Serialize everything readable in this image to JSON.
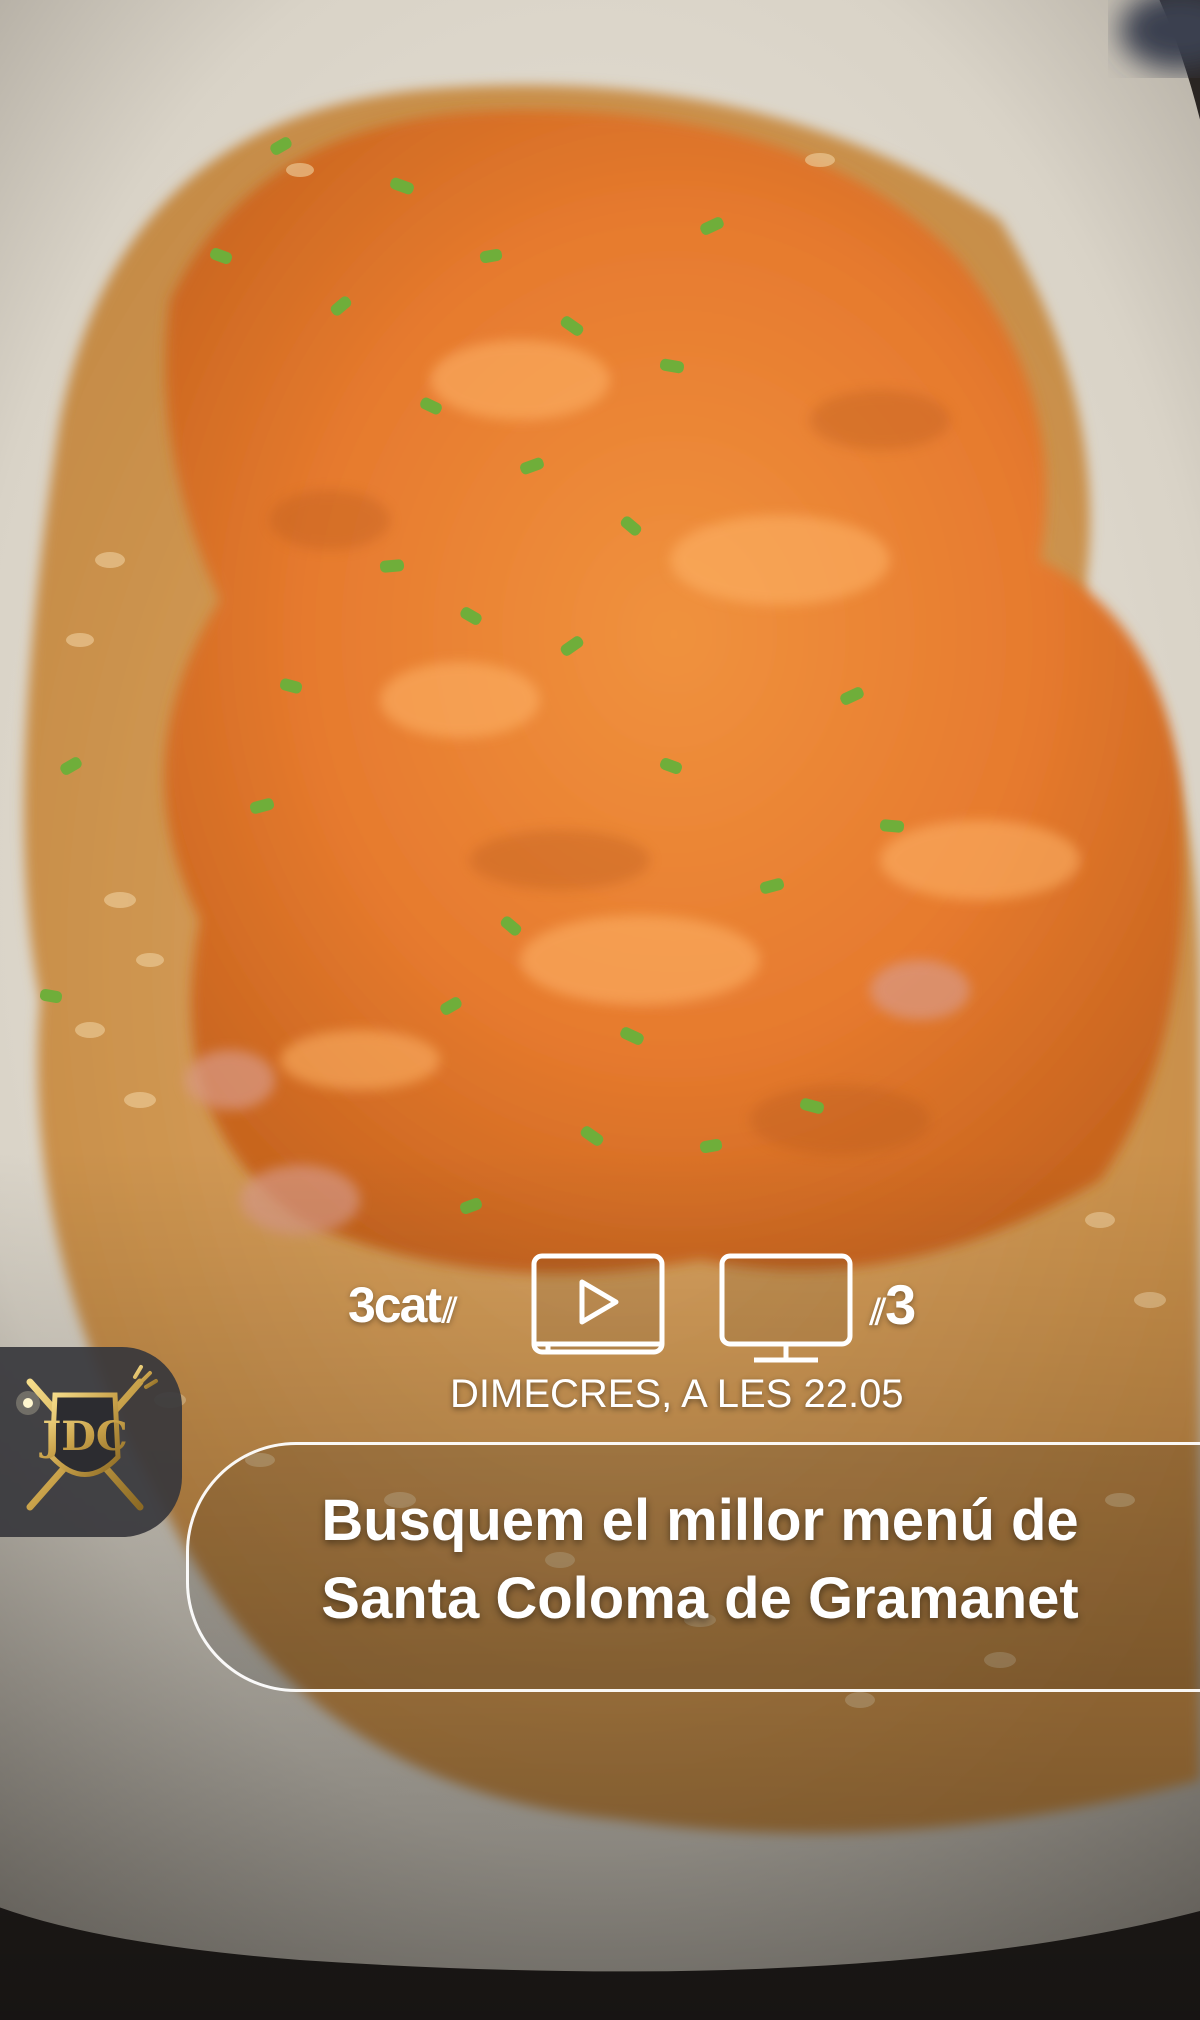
{
  "promo": {
    "platform_logo": "3cat",
    "channel_logo": "3",
    "schedule": "DIMECRES, A LES 22.05",
    "headline_line1": "Busquem el millor menú de",
    "headline_line2": "Santa Coloma de Gramanet",
    "show_logo_text": "JDC"
  },
  "icons": {
    "streaming": "play-screen-icon",
    "tv": "tv-icon",
    "show": "crossed-cutlery-shield-icon"
  },
  "colors": {
    "plate": "#e8e2d6",
    "salmon": "#e8843a",
    "rice": "#d9a15c",
    "chives": "#6ea83a",
    "gold": "#c9a24a"
  }
}
